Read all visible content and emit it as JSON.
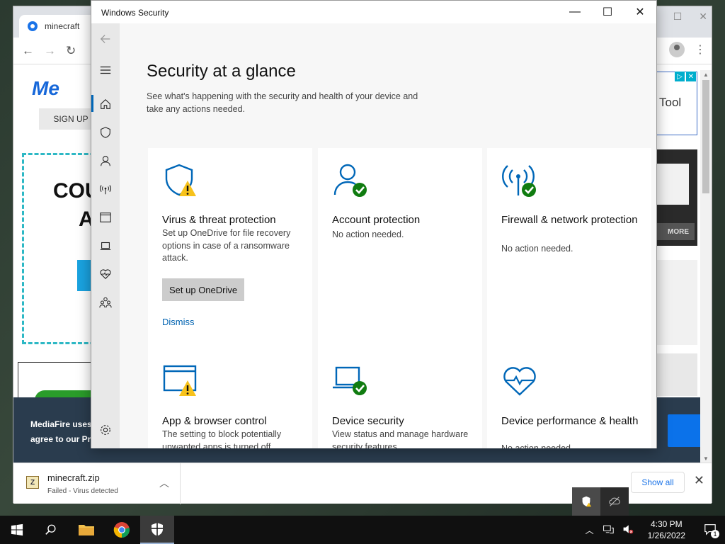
{
  "browser": {
    "tab_title": "minecraft",
    "page": {
      "logo_text": "Me",
      "signup_label": "SIGN UP",
      "promo_line1": "COU",
      "promo_line2": "A",
      "ad_text": "Tool",
      "more_label": "MORE",
      "cookie_line1": "MediaFire uses",
      "cookie_line2": "agree to our Pr"
    },
    "download": {
      "filename": "minecraft.zip",
      "status": "Failed - Virus detected",
      "show_all_label": "Show all"
    }
  },
  "security_window": {
    "title": "Windows Security",
    "heading": "Security at a glance",
    "subtitle": "See what's happening with the security and health of your device and take any actions needed.",
    "cards": [
      {
        "icon": "shield-warning-icon",
        "title": "Virus & threat protection",
        "description": "Set up OneDrive for file recovery options in case of a ransomware attack.",
        "button_label": "Set up OneDrive",
        "link_label": "Dismiss",
        "status": "warning"
      },
      {
        "icon": "account-ok-icon",
        "title": "Account protection",
        "description": "No action needed.",
        "status": "ok"
      },
      {
        "icon": "firewall-ok-icon",
        "title": "Firewall & network protection",
        "description": "No action needed.",
        "status": "ok"
      },
      {
        "icon": "browser-warning-icon",
        "title": "App & browser control",
        "description": "The setting to block potentially unwanted apps is turned off.",
        "status": "warning"
      },
      {
        "icon": "device-ok-icon",
        "title": "Device security",
        "description": "View status and manage hardware security features",
        "status": "ok"
      },
      {
        "icon": "heart-health-icon",
        "title": "Device performance & health",
        "description": "No action needed.",
        "status": "ok"
      }
    ]
  },
  "taskbar": {
    "time": "4:30 PM",
    "date": "1/26/2022",
    "notification_count": "1"
  },
  "colors": {
    "accent_blue": "#0067b8",
    "ok_green": "#107c10",
    "warning_yellow": "#f7c21b"
  }
}
